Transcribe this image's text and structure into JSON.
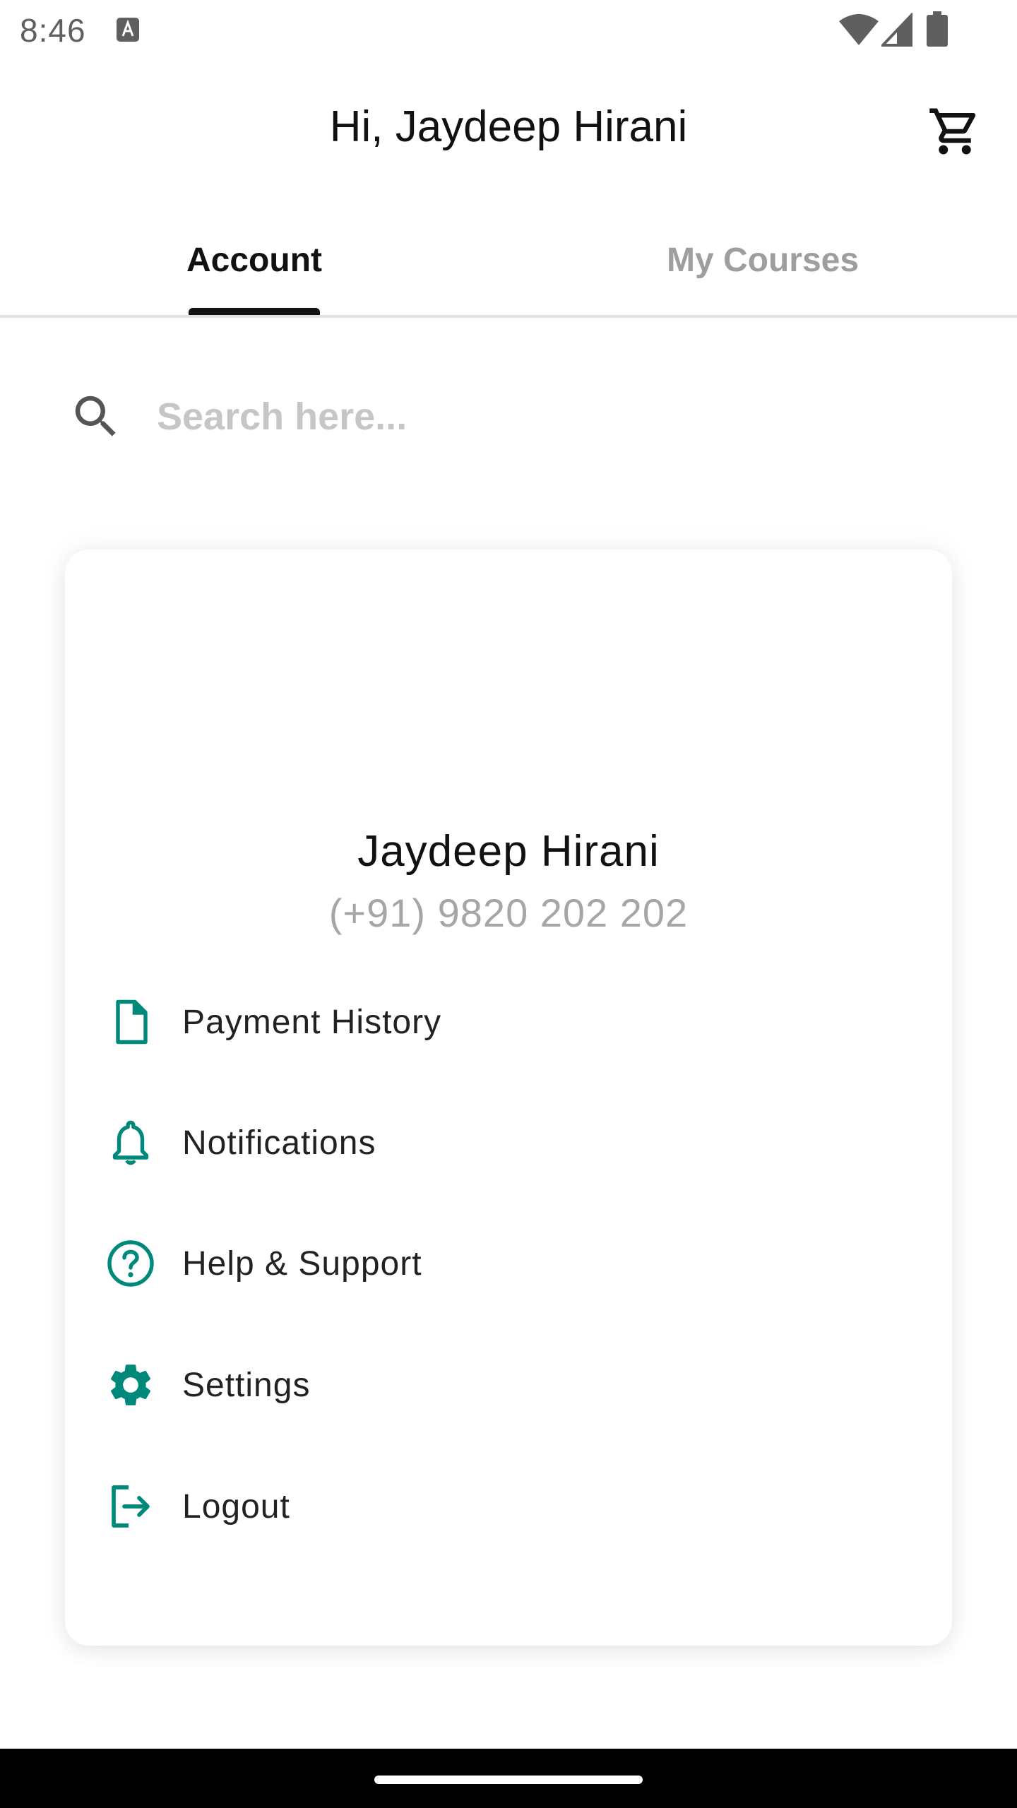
{
  "status_bar": {
    "time": "8:46",
    "icons": [
      "a-notification-icon",
      "wifi-icon",
      "signal-icon",
      "battery-icon"
    ]
  },
  "app_bar": {
    "title": "Hi, Jaydeep Hirani",
    "cart_icon": "cart-icon"
  },
  "tabs": [
    {
      "label": "Account",
      "active": true
    },
    {
      "label": "My Courses",
      "active": false
    }
  ],
  "search": {
    "placeholder": "Search here...",
    "value": ""
  },
  "profile": {
    "name": "Jaydeep Hirani",
    "phone": "(+91) 9820 202 202"
  },
  "menu": [
    {
      "label": "Payment History",
      "icon": "document-icon"
    },
    {
      "label": "Notifications",
      "icon": "bell-icon"
    },
    {
      "label": "Help & Support",
      "icon": "help-circle-icon"
    },
    {
      "label": "Settings",
      "icon": "gear-icon"
    },
    {
      "label": "Logout",
      "icon": "logout-icon"
    }
  ],
  "colors": {
    "accent": "#00897b",
    "text_primary": "#111111",
    "text_muted": "#a6a6a6",
    "tab_inactive": "#9e9e9e"
  }
}
